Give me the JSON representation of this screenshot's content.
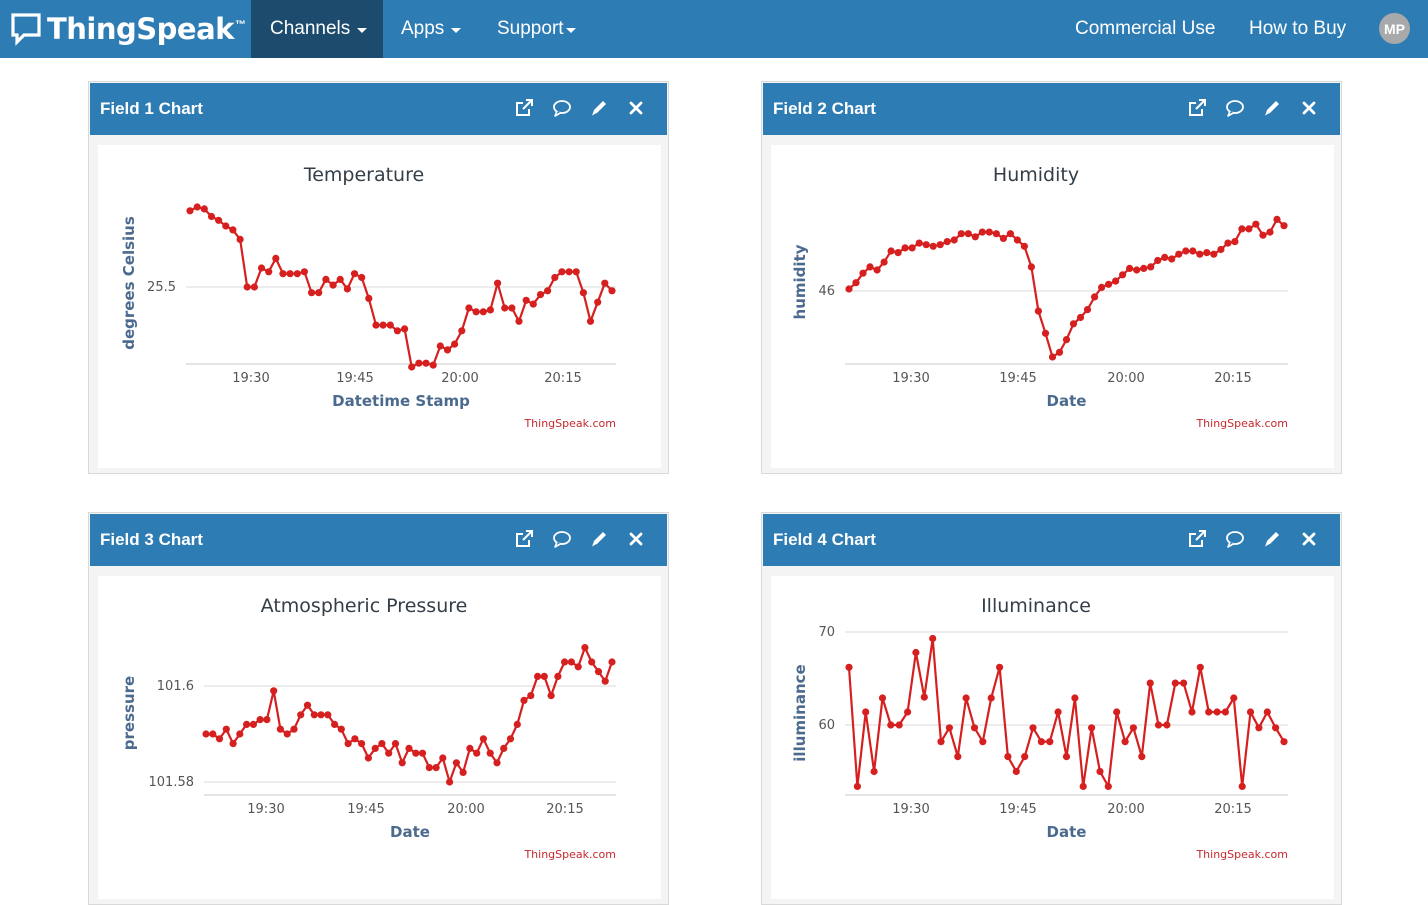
{
  "navbar": {
    "brand": "ThingSpeak",
    "brand_tm": "™",
    "channels_label": "Channels",
    "apps_label": "Apps",
    "support_label": "Support",
    "commercial_label": "Commercial Use",
    "howtobuy_label": "How to Buy",
    "avatar_initials": "MP"
  },
  "panels": [
    {
      "header": "Field 1 Chart"
    },
    {
      "header": "Field 2 Chart"
    },
    {
      "header": "Field 3 Chart"
    },
    {
      "header": "Field 4 Chart"
    }
  ],
  "chart_data": [
    {
      "type": "line",
      "title": "Temperature",
      "xlabel": "Datetime Stamp",
      "ylabel": "degrees Celsius",
      "credit": "ThingSpeak.com",
      "color": "#d62020",
      "x_ticks": [
        "19:30",
        "19:45",
        "20:00",
        "20:15"
      ],
      "y_ticks": [
        "25.5"
      ],
      "ylim": [
        25.05,
        25.95
      ],
      "values": [
        25.9,
        25.92,
        25.91,
        25.87,
        25.85,
        25.82,
        25.8,
        25.75,
        25.5,
        25.5,
        25.6,
        25.58,
        25.65,
        25.57,
        25.57,
        25.57,
        25.58,
        25.47,
        25.47,
        25.54,
        25.51,
        25.54,
        25.49,
        25.57,
        25.55,
        25.44,
        25.3,
        25.3,
        25.3,
        25.27,
        25.28,
        25.08,
        25.1,
        25.1,
        25.09,
        25.19,
        25.17,
        25.2,
        25.27,
        25.39,
        25.37,
        25.37,
        25.38,
        25.52,
        25.39,
        25.39,
        25.32,
        25.43,
        25.41,
        25.46,
        25.48,
        25.55,
        25.58,
        25.58,
        25.58,
        25.47,
        25.32,
        25.42,
        25.52,
        25.48
      ]
    },
    {
      "type": "line",
      "title": "Humidity",
      "xlabel": "Date",
      "ylabel": "humidity",
      "credit": "ThingSpeak.com",
      "color": "#d62020",
      "x_ticks": [
        "19:30",
        "19:45",
        "20:00",
        "20:15"
      ],
      "y_ticks": [
        "46"
      ],
      "ylim": [
        41.0,
        52.5
      ],
      "values": [
        46.0,
        46.4,
        47.0,
        47.4,
        47.2,
        47.7,
        48.4,
        48.3,
        48.6,
        48.6,
        48.9,
        48.8,
        48.7,
        48.8,
        49.0,
        49.1,
        49.5,
        49.5,
        49.3,
        49.6,
        49.6,
        49.5,
        49.2,
        49.5,
        49.1,
        48.7,
        47.4,
        44.6,
        43.2,
        41.7,
        42.0,
        42.8,
        43.8,
        44.2,
        44.7,
        45.5,
        46.1,
        46.3,
        46.5,
        46.9,
        47.3,
        47.2,
        47.3,
        47.4,
        47.8,
        48.0,
        47.9,
        48.2,
        48.4,
        48.4,
        48.2,
        48.3,
        48.2,
        48.5,
        48.9,
        49.0,
        49.8,
        49.8,
        50.1,
        49.4,
        49.6,
        50.4,
        50.0
      ]
    },
    {
      "type": "line",
      "title": "Atmospheric Pressure",
      "xlabel": "Date",
      "ylabel": "pressure",
      "credit": "ThingSpeak.com",
      "color": "#d62020",
      "x_ticks": [
        "19:30",
        "19:45",
        "20:00",
        "20:15"
      ],
      "y_ticks": [
        "101.6",
        "101.58"
      ],
      "ylim": [
        101.577,
        101.611
      ],
      "values": [
        101.59,
        101.59,
        101.589,
        101.591,
        101.588,
        101.59,
        101.592,
        101.592,
        101.593,
        101.593,
        101.599,
        101.591,
        101.59,
        101.591,
        101.594,
        101.596,
        101.594,
        101.594,
        101.594,
        101.592,
        101.591,
        101.588,
        101.589,
        101.588,
        101.585,
        101.587,
        101.588,
        101.586,
        101.588,
        101.584,
        101.587,
        101.586,
        101.586,
        101.583,
        101.583,
        101.585,
        101.58,
        101.584,
        101.582,
        101.587,
        101.586,
        101.589,
        101.586,
        101.584,
        101.587,
        101.589,
        101.592,
        101.597,
        101.598,
        101.602,
        101.602,
        101.598,
        101.602,
        101.605,
        101.605,
        101.604,
        101.608,
        101.605,
        101.603,
        101.601,
        101.605
      ]
    },
    {
      "type": "line",
      "title": "Illuminance",
      "xlabel": "Date",
      "ylabel": "illuminance",
      "credit": "ThingSpeak.com",
      "color": "#d62020",
      "x_ticks": [
        "19:30",
        "19:45",
        "20:00",
        "20:15"
      ],
      "y_ticks": [
        "70",
        "60"
      ],
      "ylim": [
        52.5,
        70
      ],
      "values": [
        66.2,
        53.4,
        61.4,
        55.0,
        62.9,
        60.0,
        60.0,
        61.4,
        67.8,
        63.0,
        69.3,
        58.2,
        59.7,
        56.6,
        62.9,
        59.7,
        58.2,
        62.9,
        66.2,
        56.6,
        55.0,
        56.6,
        59.7,
        58.2,
        58.2,
        61.4,
        56.6,
        62.9,
        53.4,
        59.7,
        55.0,
        53.4,
        61.4,
        58.2,
        59.7,
        56.6,
        64.5,
        60.0,
        60.0,
        64.5,
        64.5,
        61.4,
        66.2,
        61.4,
        61.4,
        61.4,
        62.9,
        53.4,
        61.4,
        59.7,
        61.4,
        59.7,
        58.2
      ]
    }
  ]
}
